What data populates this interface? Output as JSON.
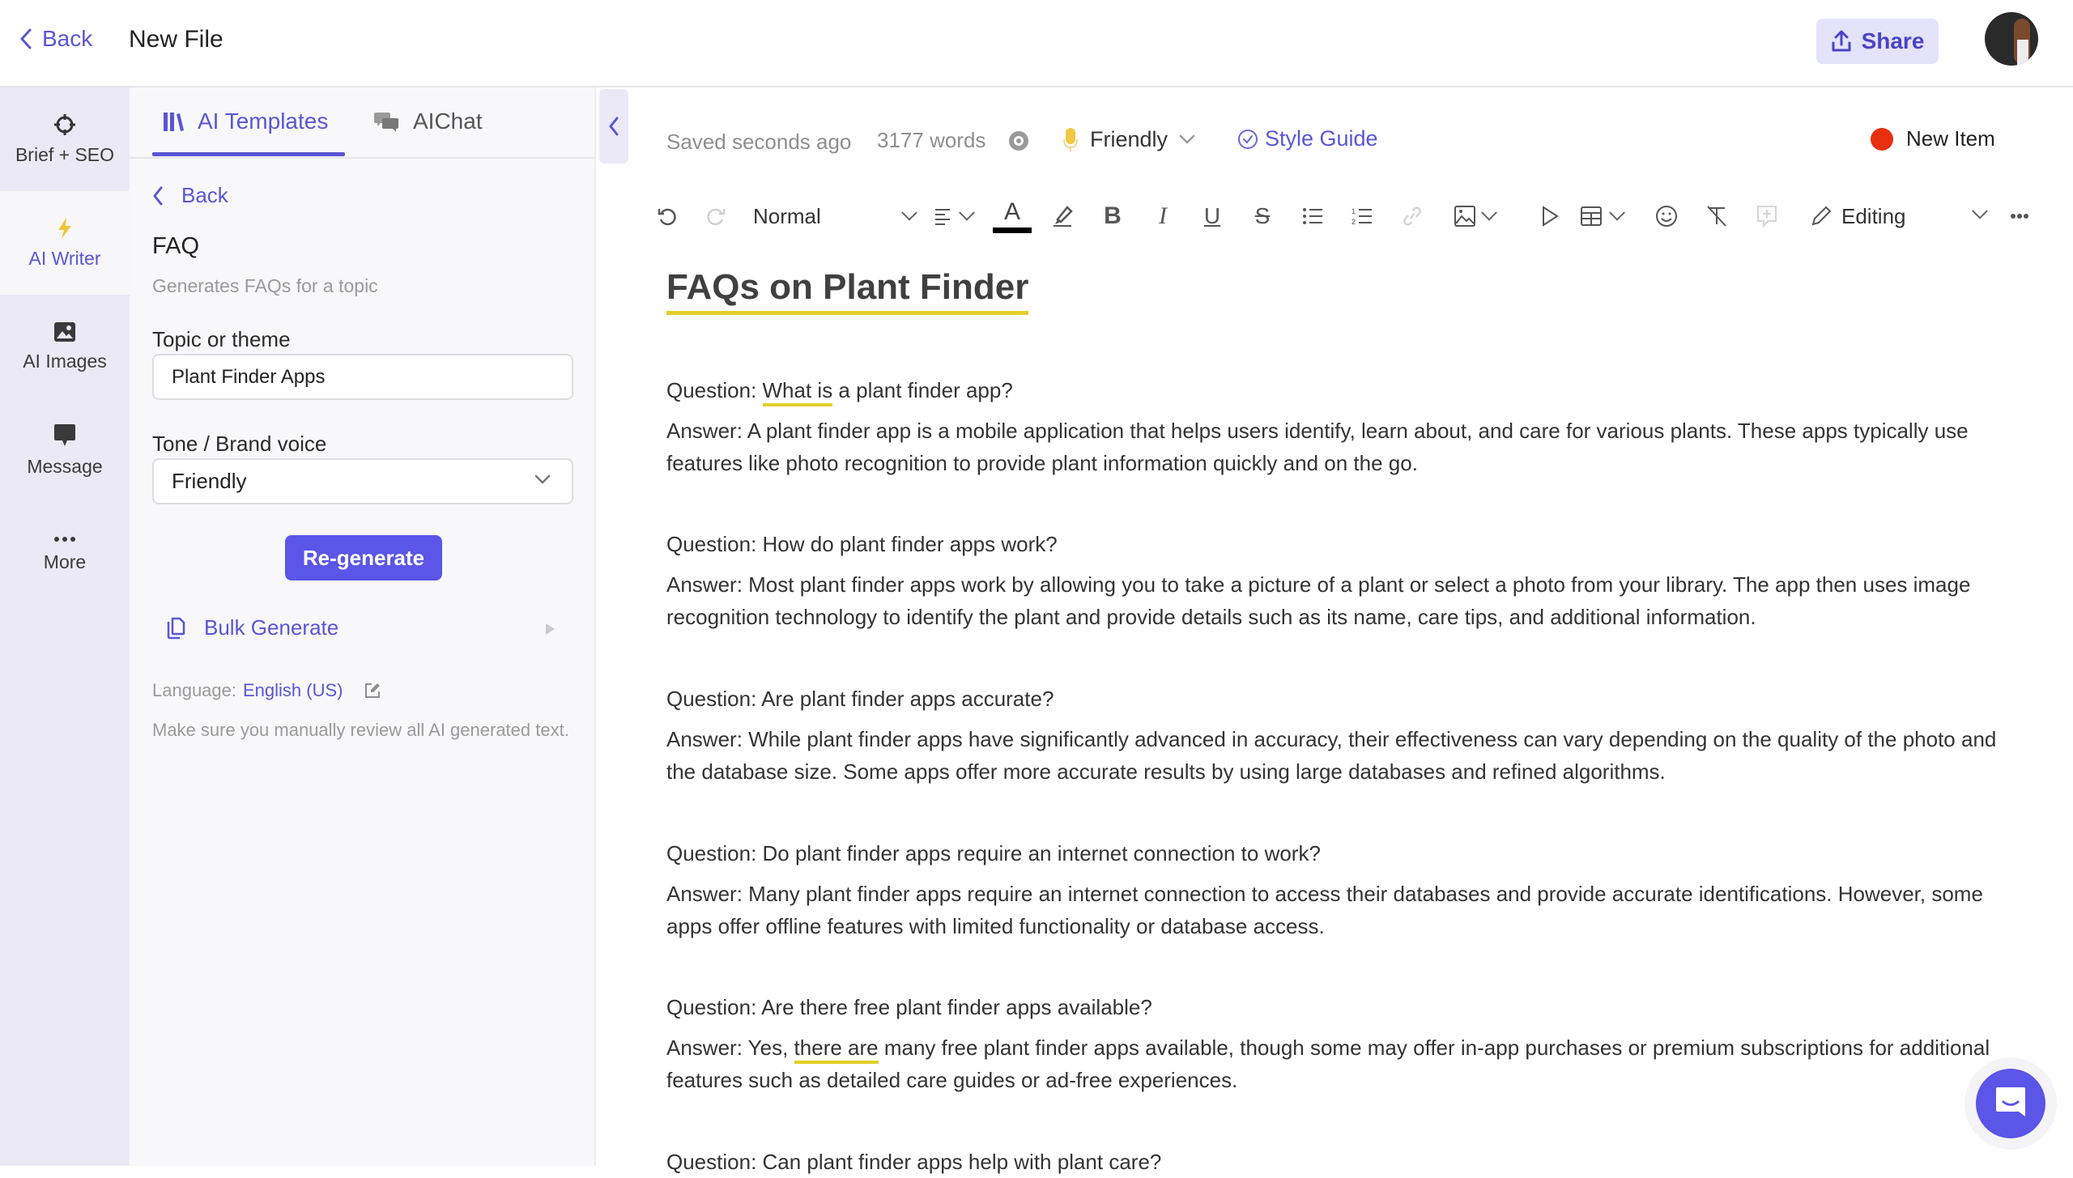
{
  "header": {
    "back_label": "Back",
    "file_title": "New File",
    "share_label": "Share"
  },
  "rail": {
    "items": [
      {
        "label": "Brief + SEO",
        "icon": "crosshair-icon"
      },
      {
        "label": "AI Writer",
        "icon": "lightning-icon",
        "active": true
      },
      {
        "label": "AI Images",
        "icon": "image-icon"
      },
      {
        "label": "Message",
        "icon": "message-icon"
      },
      {
        "label": "More",
        "icon": "more-dots-icon"
      }
    ]
  },
  "panel": {
    "tabs": [
      {
        "label": "AI Templates",
        "active": true
      },
      {
        "label": "AIChat"
      }
    ],
    "back_label": "Back",
    "template_title": "FAQ",
    "template_desc": "Generates FAQs for a topic",
    "topic_label": "Topic or theme",
    "topic_value": "Plant Finder Apps",
    "tone_label": "Tone / Brand voice",
    "tone_value": "Friendly",
    "regenerate_label": "Re-generate",
    "bulk_label": "Bulk Generate",
    "language_label": "Language:",
    "language_value": "English (US)",
    "disclaimer": "Make sure you manually review all AI generated text."
  },
  "editor": {
    "saved_status": "Saved seconds ago",
    "word_count": "3177 words",
    "tone": "Friendly",
    "style_guide_label": "Style Guide",
    "new_item_label": "New Item",
    "toolbar": {
      "paragraph_style": "Normal",
      "mode": "Editing"
    },
    "doc_title": "FAQs on Plant Finder",
    "faqs": [
      {
        "q_prefix": "Question: ",
        "q_hl": "What is",
        "q_rest": " a plant finder app?",
        "a": "Answer: A plant finder app is a mobile application that helps users identify, learn about, and care for various plants. These apps typically use features like photo recognition to provide plant information quickly and on the go."
      },
      {
        "q": "Question: How do plant finder apps work?",
        "a": "Answer: Most plant finder apps work by allowing you to take a picture of a plant or select a photo from your library. The app then uses image recognition technology to identify the plant and provide details such as its name, care tips, and additional information."
      },
      {
        "q": "Question: Are plant finder apps accurate?",
        "a": "Answer: While plant finder apps have significantly advanced in accuracy, their effectiveness can vary depending on the quality of the photo and the database size. Some apps offer more accurate results by using large databases and refined algorithms."
      },
      {
        "q": "Question: Do plant finder apps require an internet connection to work?",
        "a": "Answer: Many plant finder apps require an internet connection to access their databases and provide accurate identifications. However, some apps offer offline features with limited functionality or database access."
      },
      {
        "q": "Question: Are there free plant finder apps available?",
        "a_prefix": "Answer: Yes, ",
        "a_hl": "there are",
        "a_rest": " many free plant finder apps available, though some may offer in-app purchases or premium subscriptions for additional features such as detailed care guides or ad-free experiences."
      },
      {
        "q": "Question: Can plant finder apps help with plant care?"
      }
    ]
  },
  "colors": {
    "accent": "#5b55e8",
    "highlight_underline": "#e2cf2a",
    "new_item_dot": "#e8300f",
    "rail_bg": "#ebe9f6",
    "panel_bg": "#f8f8fa"
  }
}
